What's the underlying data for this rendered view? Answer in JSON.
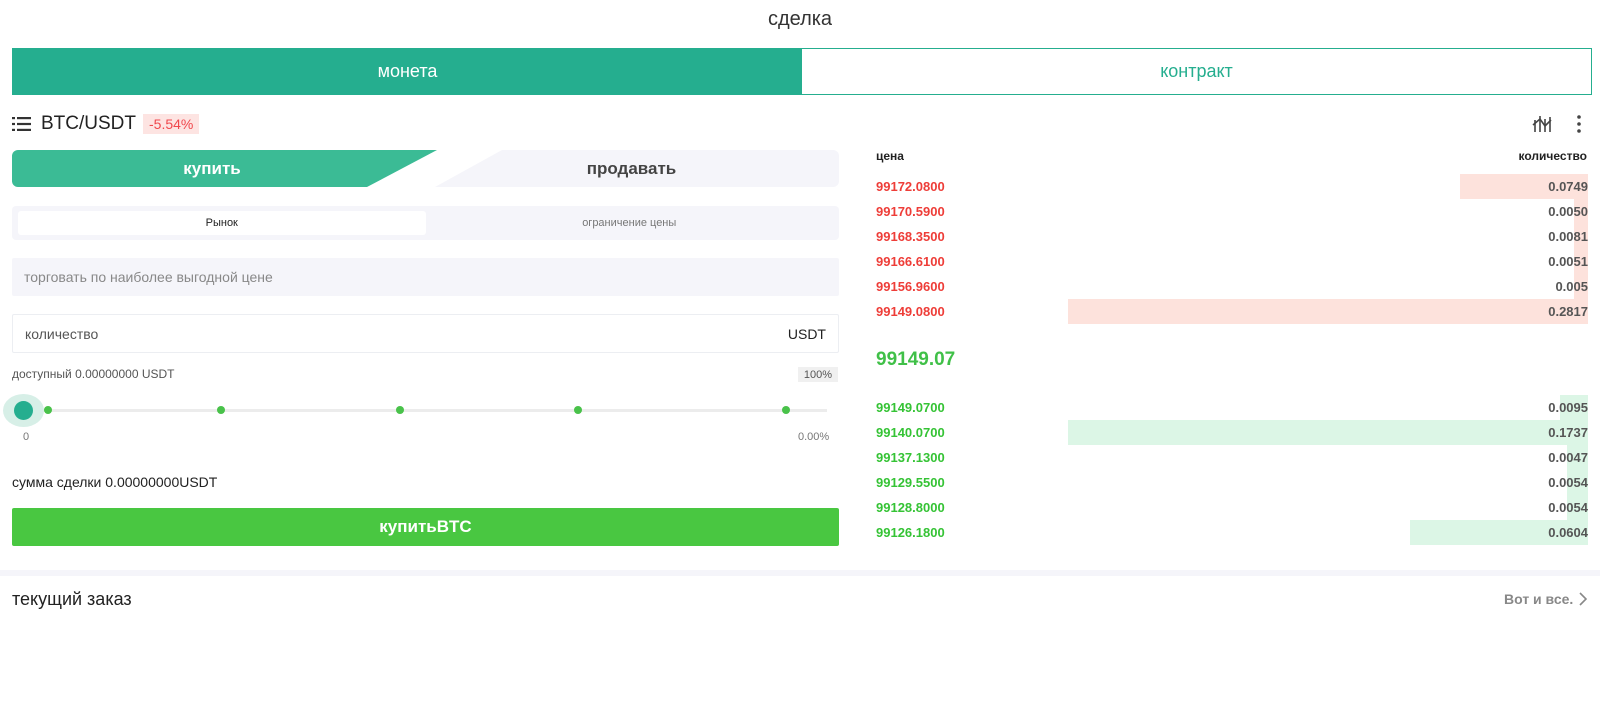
{
  "page": {
    "title": "сделка"
  },
  "top_tabs": [
    {
      "label": "монета",
      "active": true
    },
    {
      "label": "контракт",
      "active": false
    }
  ],
  "pair": {
    "name": "BTC/USDT",
    "change": "-5.54%"
  },
  "icons": {
    "list": "list-icon",
    "chart": "candlestick-chart-icon",
    "more": "more-vertical-icon",
    "chevron": "chevron-right-icon"
  },
  "side_tabs": {
    "buy": "купить",
    "sell": "продавать"
  },
  "order_types": [
    {
      "label": "Рынок",
      "active": true
    },
    {
      "label": "ограничение цены",
      "active": false
    }
  ],
  "price_field": {
    "placeholder": "торговать по наиболее выгодной цене"
  },
  "amount_field": {
    "label": "количество",
    "unit": "USDT"
  },
  "available": "доступный 0.00000000 USDT",
  "percent_badge": "100%",
  "slider": {
    "min_label": "0",
    "max_label": "0.00%",
    "value": 0
  },
  "trade_sum": "сумма сделки 0.00000000USDT",
  "buy_button": "купитьBTC",
  "orderbook": {
    "price_header": "цена",
    "qty_header": "количество",
    "asks": [
      {
        "price": "99172.0800",
        "qty": "0.0749",
        "depth": 0.18
      },
      {
        "price": "99170.5900",
        "qty": "0.0050",
        "depth": 0.02
      },
      {
        "price": "99168.3500",
        "qty": "0.0081",
        "depth": 0.02
      },
      {
        "price": "99166.6100",
        "qty": "0.0051",
        "depth": 0.02
      },
      {
        "price": "99156.9600",
        "qty": "0.005",
        "depth": 0.02
      },
      {
        "price": "99149.0800",
        "qty": "0.2817",
        "depth": 0.73
      }
    ],
    "last_price": "99149.07",
    "bids": [
      {
        "price": "99149.0700",
        "qty": "0.0095",
        "depth": 0.04
      },
      {
        "price": "99140.0700",
        "qty": "0.1737",
        "depth": 0.73
      },
      {
        "price": "99137.1300",
        "qty": "0.0047",
        "depth": 0.03
      },
      {
        "price": "99129.5500",
        "qty": "0.0054",
        "depth": 0.03
      },
      {
        "price": "99128.8000",
        "qty": "0.0054",
        "depth": 0.03
      },
      {
        "price": "99126.1800",
        "qty": "0.0604",
        "depth": 0.25
      }
    ]
  },
  "current_order": {
    "title": "текущий заказ",
    "view_all": "Вот и все."
  },
  "colors": {
    "brand": "#25ae8f",
    "buy_green": "#49c741",
    "ask_red": "#ee3d38",
    "bid_green": "#35c335",
    "change_bg": "#fde4e2"
  }
}
